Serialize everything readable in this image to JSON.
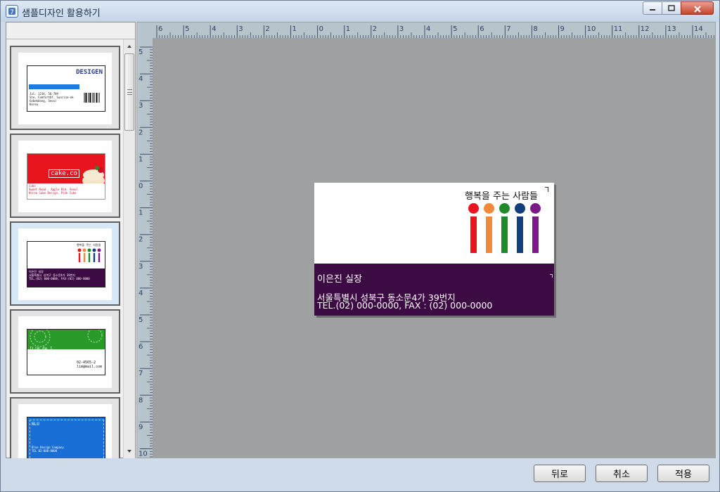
{
  "window": {
    "title": "샘플디자인 활용하기"
  },
  "thumbnails": [
    {
      "name": "designen",
      "heading": "DESIGEN",
      "lines": [
        "Jul. 1234, 56-789",
        "Ste. ComfortOf, Sunrise-ok",
        "Gobekdong, Seoul",
        "Korea"
      ],
      "colors": {
        "accent": "#1a7be3"
      }
    },
    {
      "name": "cake",
      "heading": "cake.co",
      "lines": [
        "Cake",
        "Sweet Road . Apple Bld. Seoul",
        "Korea Cake Design, Pink Cake"
      ],
      "colors": {
        "accent": "#e8141e"
      }
    },
    {
      "name": "happy-people",
      "heading": "행복을 주는 사람들",
      "lines": [
        "이은진 실장",
        "서울특별시 성북구 동소문4가 39번지",
        "TEL.(02) 000-0000, FAX:(02) 000-0000"
      ],
      "colors": {
        "accent": "#3d0b43"
      }
    },
    {
      "name": "green-circle",
      "heading": "[Lim.de.]",
      "lines": [
        "02-4565-2",
        "lim@mail.com"
      ],
      "colors": {
        "accent": "#2a9b2a"
      }
    },
    {
      "name": "blue-card",
      "heading": "BLU",
      "lines": [
        "Blue Design Company",
        "TEL 02-000-0000"
      ],
      "colors": {
        "accent": "#1a6fd6"
      }
    }
  ],
  "preview": {
    "ruler_top_labels": [
      "6",
      "5",
      "4",
      "3",
      "2",
      "1",
      "0",
      "1",
      "2",
      "3",
      "4",
      "5",
      "6",
      "7",
      "8",
      "9",
      "10",
      "11",
      "12",
      "13",
      "14"
    ],
    "ruler_left_labels": [
      "5",
      "4",
      "3",
      "2",
      "1",
      "0",
      "1",
      "2",
      "3",
      "4",
      "5",
      "6",
      "7",
      "8",
      "9",
      "10"
    ],
    "card": {
      "slogan": "행복을 주는 사람들",
      "name_title": "이은진 실장",
      "address": "서울특별시 성북구 동소문4가 39번지",
      "contact": "TEL.(02) 000-0000, FAX : (02) 000-0000",
      "figure_colors": [
        "#e8141e",
        "#f08a3a",
        "#1f8a2a",
        "#123f7a",
        "#7a1a86"
      ],
      "band_color": "#3d0b43"
    }
  },
  "buttons": {
    "back": "뒤로",
    "cancel": "취소",
    "apply": "적용"
  }
}
